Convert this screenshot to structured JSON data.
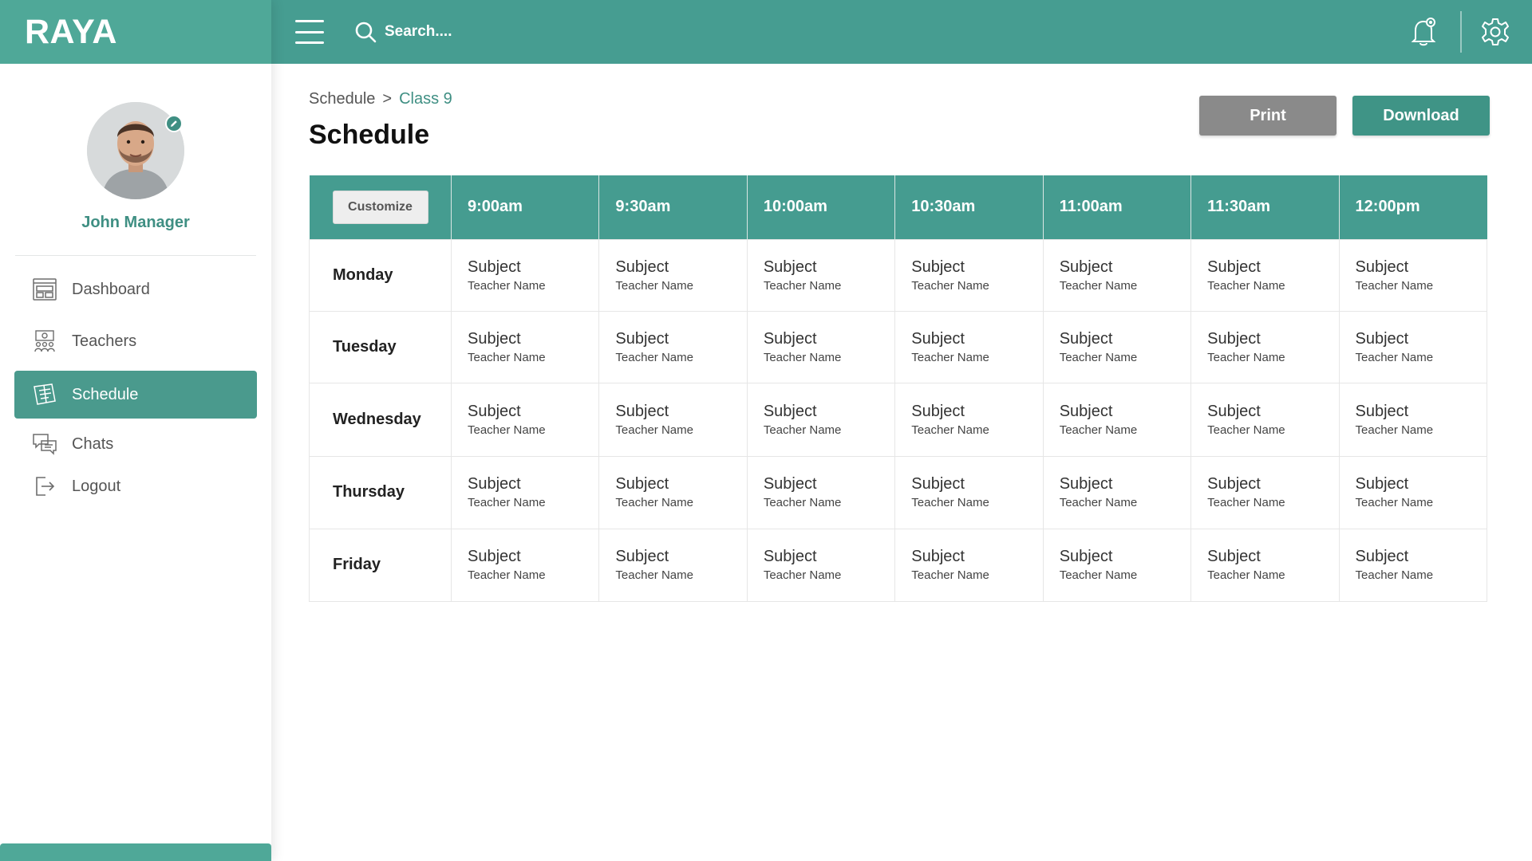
{
  "brand": {
    "logo": "RAYA",
    "accent": "#469d91"
  },
  "topbar": {
    "search_placeholder": "Search....",
    "icons": [
      "menu-icon",
      "search-icon",
      "bell-icon",
      "gear-icon"
    ]
  },
  "profile": {
    "name": "John Manager"
  },
  "sidebar": {
    "items": [
      {
        "label": "Dashboard",
        "icon": "dashboard-icon",
        "active": false
      },
      {
        "label": "Teachers",
        "icon": "teachers-icon",
        "active": false
      },
      {
        "label": "Schedule",
        "icon": "schedule-icon",
        "active": true
      },
      {
        "label": "Chats",
        "icon": "chat-icon",
        "active": false
      },
      {
        "label": "Logout",
        "icon": "logout-icon",
        "active": false
      }
    ]
  },
  "breadcrumb": {
    "root": "Schedule",
    "separator": ">",
    "current": "Class 9"
  },
  "page": {
    "title": "Schedule"
  },
  "actions": {
    "print": "Print",
    "download": "Download"
  },
  "schedule": {
    "customize_label": "Customize",
    "times": [
      "9:00am",
      "9:30am",
      "10:00am",
      "10:30am",
      "11:00am",
      "11:30am",
      "12:00pm"
    ],
    "days": [
      "Monday",
      "Tuesday",
      "Wednesday",
      "Thursday",
      "Friday"
    ],
    "cell": {
      "subject": "Subject",
      "teacher": "Teacher Name"
    }
  }
}
